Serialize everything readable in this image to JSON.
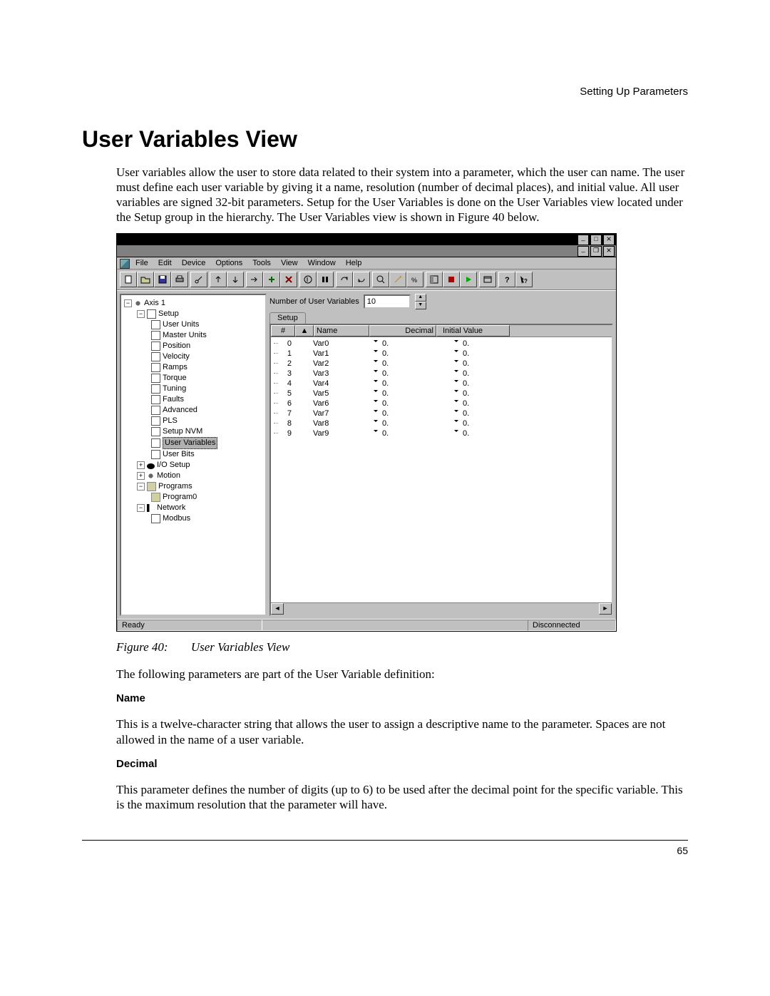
{
  "running_head": "Setting Up Parameters",
  "h1": "User Variables View",
  "intro": "User variables allow the user to store data related to their system into a parameter, which the user can name. The user must define each user variable by giving it a name, resolution (number of decimal places), and initial value. All user variables are signed 32-bit parameters. Setup for the User Variables is done on the User Variables view located under the Setup group in the hierarchy. The User Variables view is shown in Figure 40 below.",
  "figure": {
    "label": "Figure 40:",
    "title": "User Variables View"
  },
  "after_fig_line": "The following parameters are part of the User Variable definition:",
  "sub_name": "Name",
  "name_para": "This is a twelve-character string that allows the user to assign a descriptive name to the parameter. Spaces are not allowed in the name of a user variable.",
  "sub_decimal": "Decimal",
  "decimal_para": "This parameter defines the number of digits (up to 6) to be used after the decimal point for the specific variable. This is the maximum resolution that the parameter will have.",
  "page_number": "65",
  "app": {
    "menu": [
      "File",
      "Edit",
      "Device",
      "Options",
      "Tools",
      "View",
      "Window",
      "Help"
    ],
    "num_label": "Number of User Variables",
    "num_value": "10",
    "tab_label": "Setup",
    "columns": {
      "idx": "#",
      "name": "Name",
      "decimal": "Decimal",
      "initial": "Initial Value"
    },
    "rows": [
      {
        "i": "0",
        "name": "Var0",
        "dec": "0.",
        "init": "0."
      },
      {
        "i": "1",
        "name": "Var1",
        "dec": "0.",
        "init": "0."
      },
      {
        "i": "2",
        "name": "Var2",
        "dec": "0.",
        "init": "0."
      },
      {
        "i": "3",
        "name": "Var3",
        "dec": "0.",
        "init": "0."
      },
      {
        "i": "4",
        "name": "Var4",
        "dec": "0.",
        "init": "0."
      },
      {
        "i": "5",
        "name": "Var5",
        "dec": "0.",
        "init": "0."
      },
      {
        "i": "6",
        "name": "Var6",
        "dec": "0.",
        "init": "0."
      },
      {
        "i": "7",
        "name": "Var7",
        "dec": "0.",
        "init": "0."
      },
      {
        "i": "8",
        "name": "Var8",
        "dec": "0.",
        "init": "0."
      },
      {
        "i": "9",
        "name": "Var9",
        "dec": "0.",
        "init": "0."
      }
    ],
    "status_ready": "Ready",
    "status_disconnected": "Disconnected",
    "tree": {
      "axis": "Axis 1",
      "setup": "Setup",
      "setup_children": [
        "User Units",
        "Master Units",
        "Position",
        "Velocity",
        "Ramps",
        "Torque",
        "Tuning",
        "Faults",
        "Advanced",
        "PLS",
        "Setup NVM",
        "User Variables",
        "User Bits"
      ],
      "selected": "User Variables",
      "io": "I/O Setup",
      "motion": "Motion",
      "programs": "Programs",
      "program0": "Program0",
      "network": "Network",
      "modbus": "Modbus"
    }
  }
}
